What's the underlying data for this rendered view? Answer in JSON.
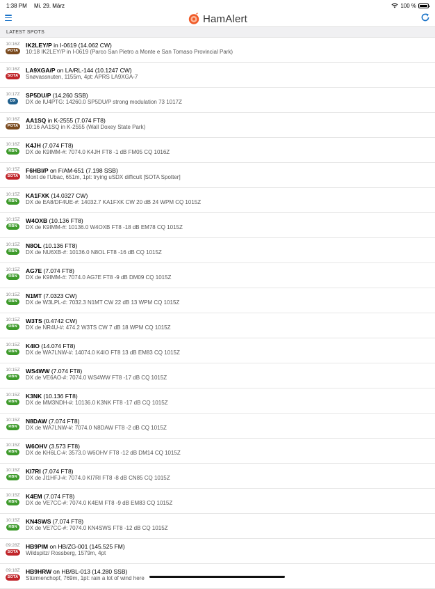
{
  "status": {
    "time": "1:38 PM",
    "date": "Mi. 29. März",
    "battery": "100 %"
  },
  "app": {
    "title": "HamAlert",
    "section": "LATEST SPOTS"
  },
  "badge_colors": {
    "POTA": "#7a4a1e",
    "SOTA": "#c0252a",
    "DX": "#1f5f8c",
    "RBN": "#3d9a2a"
  },
  "spots": [
    {
      "time": "10:16Z",
      "source": "POTA",
      "call": "IK2LEY/P",
      "mid": " in ",
      "ref": "I-0619",
      "freq": " (14.062 CW)",
      "detail": "10:18 IK2LEY/P in I-0619 (Parco San Pietro a Monte e San Tomaso Provincial Park)"
    },
    {
      "time": "10:16Z",
      "source": "SOTA",
      "call": "LA9XGA/P",
      "mid": " on ",
      "ref": "LA/RL-144",
      "freq": " (10.1247 CW)",
      "detail": "Snøvassnuten, 1155m, 4pt: APRS LA9XGA-7"
    },
    {
      "time": "10:17Z",
      "source": "DX",
      "call": "SP5DU/P",
      "mid": "",
      "ref": "",
      "freq": " (14.260 SSB)",
      "detail": "DX de IU4PTG: 14260.0 SP5DU/P strong modulation 73 1017Z"
    },
    {
      "time": "10:16Z",
      "source": "POTA",
      "call": "AA1SQ",
      "mid": " in ",
      "ref": "K-2555",
      "freq": " (7.074 FT8)",
      "detail": "10:16 AA1SQ in K-2555 (Wall Doxey State Park)"
    },
    {
      "time": "10:16Z",
      "source": "RBN",
      "call": "K4JH",
      "mid": "",
      "ref": "",
      "freq": " (7.074 FT8)",
      "detail": "DX de K9IMM-#: 7074.0 K4JH FT8 -1 dB FM05 CQ 1016Z"
    },
    {
      "time": "10:15Z",
      "source": "SOTA",
      "call": "F6HBI/P",
      "mid": " on ",
      "ref": "F/AM-651",
      "freq": " (7.198 SSB)",
      "detail": "Mont de l'Ubac, 651m, 1pt: trying uSDX difficult [SOTA Spotter]"
    },
    {
      "time": "10:15Z",
      "source": "RBN",
      "call": "KA1FXK",
      "mid": "",
      "ref": "",
      "freq": " (14.0327 CW)",
      "detail": "DX de EA8/DF4UE-#: 14032.7 KA1FXK CW 20 dB 24 WPM CQ 1015Z"
    },
    {
      "time": "10:15Z",
      "source": "RBN",
      "call": "W4OXB",
      "mid": "",
      "ref": "",
      "freq": " (10.136 FT8)",
      "detail": "DX de K9IMM-#: 10136.0 W4OXB FT8 -18 dB EM78 CQ 1015Z"
    },
    {
      "time": "10:15Z",
      "source": "RBN",
      "call": "N8OL",
      "mid": "",
      "ref": "",
      "freq": " (10.136 FT8)",
      "detail": "DX de NU6XB-#: 10136.0 N8OL FT8 -16 dB CQ 1015Z"
    },
    {
      "time": "10:15Z",
      "source": "RBN",
      "call": "AG7E",
      "mid": "",
      "ref": "",
      "freq": " (7.074 FT8)",
      "detail": "DX de K9IMM-#: 7074.0 AG7E FT8 -9 dB DM09 CQ 1015Z"
    },
    {
      "time": "10:15Z",
      "source": "RBN",
      "call": "N1MT",
      "mid": "",
      "ref": "",
      "freq": " (7.0323 CW)",
      "detail": "DX de W3LPL-#: 7032.3 N1MT CW 22 dB 13 WPM CQ 1015Z"
    },
    {
      "time": "10:15Z",
      "source": "RBN",
      "call": "W3TS",
      "mid": "",
      "ref": "",
      "freq": " (0.4742 CW)",
      "detail": "DX de NR4U-#: 474.2 W3TS CW 7 dB 18 WPM CQ 1015Z"
    },
    {
      "time": "10:15Z",
      "source": "RBN",
      "call": "K4IO",
      "mid": "",
      "ref": "",
      "freq": " (14.074 FT8)",
      "detail": "DX de WA7LNW-#: 14074.0 K4IO FT8 13 dB EM83 CQ 1015Z"
    },
    {
      "time": "10:15Z",
      "source": "RBN",
      "call": "WS4WW",
      "mid": "",
      "ref": "",
      "freq": " (7.074 FT8)",
      "detail": "DX de VE6AO-#: 7074.0 WS4WW FT8 -17 dB CQ 1015Z"
    },
    {
      "time": "10:15Z",
      "source": "RBN",
      "call": "K3NK",
      "mid": "",
      "ref": "",
      "freq": " (10.136 FT8)",
      "detail": "DX de MM3NDH-#: 10136.0 K3NK FT8 -17 dB CQ 1015Z"
    },
    {
      "time": "10:15Z",
      "source": "RBN",
      "call": "N8DAW",
      "mid": "",
      "ref": "",
      "freq": " (7.074 FT8)",
      "detail": "DX de WA7LNW-#: 7074.0 N8DAW FT8 -2 dB CQ 1015Z"
    },
    {
      "time": "10:15Z",
      "source": "RBN",
      "call": "W6OHV",
      "mid": "",
      "ref": "",
      "freq": " (3.573 FT8)",
      "detail": "DX de KH6LC-#: 3573.0 W6OHV FT8 -12 dB DM14 CQ 1015Z"
    },
    {
      "time": "10:15Z",
      "source": "RBN",
      "call": "KI7RI",
      "mid": "",
      "ref": "",
      "freq": " (7.074 FT8)",
      "detail": "DX de JI1HFJ-#: 7074.0 KI7RI FT8 -8 dB CN85 CQ 1015Z"
    },
    {
      "time": "10:15Z",
      "source": "RBN",
      "call": "K4EM",
      "mid": "",
      "ref": "",
      "freq": " (7.074 FT8)",
      "detail": "DX de VE7CC-#: 7074.0 K4EM FT8 -9 dB EM83 CQ 1015Z"
    },
    {
      "time": "10:15Z",
      "source": "RBN",
      "call": "KN4SWS",
      "mid": "",
      "ref": "",
      "freq": " (7.074 FT8)",
      "detail": "DX de VE7CC-#: 7074.0 KN4SWS FT8 -12 dB CQ 1015Z"
    },
    {
      "time": "09:28Z",
      "source": "SOTA",
      "call": "HB9PIM",
      "mid": " on ",
      "ref": "HB/ZG-001",
      "freq": " (145.525 FM)",
      "detail": "Wildspitz/ Rossberg, 1579m, 4pt"
    },
    {
      "time": "09:18Z",
      "source": "SOTA",
      "call": "HB9HRW",
      "mid": " on ",
      "ref": "HB/BL-013",
      "freq": " (14.280 SSB)",
      "detail": "Stürmenchopf, 769m, 1pt: rain a lot of wind here"
    }
  ]
}
